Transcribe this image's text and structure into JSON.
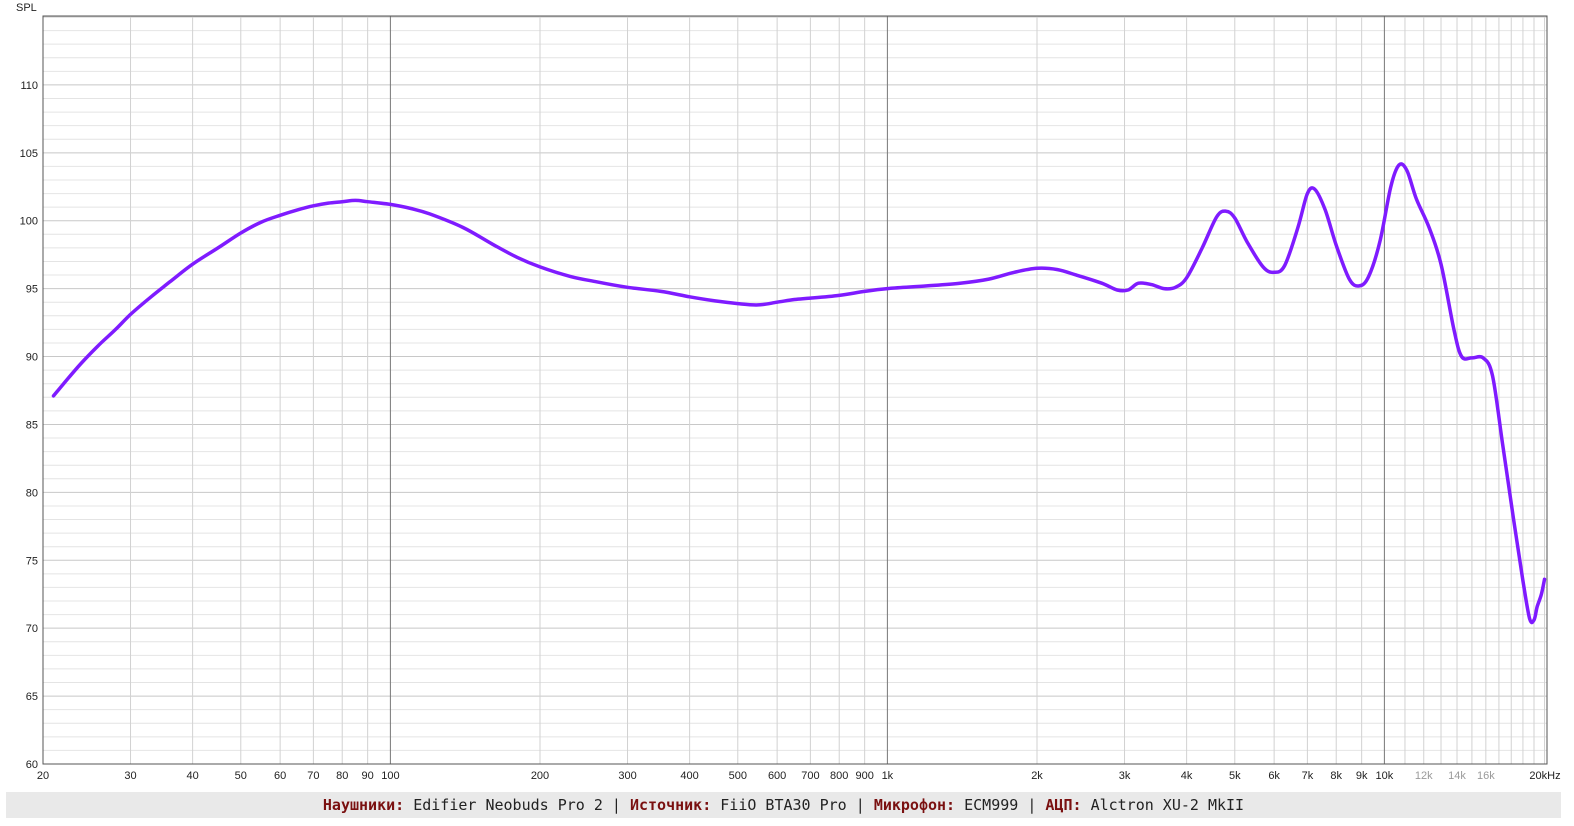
{
  "chart_data": {
    "type": "line",
    "ylabel": "SPL",
    "xscale": "log",
    "xlim": [
      20,
      20000
    ],
    "ylim": [
      60,
      115
    ],
    "grid": true,
    "y_ticks": [
      60,
      65,
      70,
      75,
      80,
      85,
      90,
      95,
      100,
      105,
      110
    ],
    "x_ticks": [
      {
        "value": 20,
        "label": "20"
      },
      {
        "value": 30,
        "label": "30"
      },
      {
        "value": 40,
        "label": "40"
      },
      {
        "value": 50,
        "label": "50"
      },
      {
        "value": 60,
        "label": "60"
      },
      {
        "value": 70,
        "label": "70"
      },
      {
        "value": 80,
        "label": "80"
      },
      {
        "value": 90,
        "label": "90"
      },
      {
        "value": 100,
        "label": "100"
      },
      {
        "value": 200,
        "label": "200"
      },
      {
        "value": 300,
        "label": "300"
      },
      {
        "value": 400,
        "label": "400"
      },
      {
        "value": 500,
        "label": "500"
      },
      {
        "value": 600,
        "label": "600"
      },
      {
        "value": 700,
        "label": "700"
      },
      {
        "value": 800,
        "label": "800"
      },
      {
        "value": 900,
        "label": "900"
      },
      {
        "value": 1000,
        "label": "1k"
      },
      {
        "value": 2000,
        "label": "2k"
      },
      {
        "value": 3000,
        "label": "3k"
      },
      {
        "value": 4000,
        "label": "4k"
      },
      {
        "value": 5000,
        "label": "5k"
      },
      {
        "value": 6000,
        "label": "6k"
      },
      {
        "value": 7000,
        "label": "7k"
      },
      {
        "value": 8000,
        "label": "8k"
      },
      {
        "value": 9000,
        "label": "9k"
      },
      {
        "value": 10000,
        "label": "10k"
      },
      {
        "value": 12000,
        "label": "12k",
        "muted": true
      },
      {
        "value": 14000,
        "label": "14k",
        "muted": true
      },
      {
        "value": 16000,
        "label": "16k",
        "muted": true
      },
      {
        "value": 20000,
        "label": "20kHz"
      }
    ],
    "series": [
      {
        "color": "#7f1bff",
        "points": [
          [
            21,
            87.1
          ],
          [
            22,
            88.0
          ],
          [
            24,
            89.6
          ],
          [
            26,
            90.9
          ],
          [
            28,
            92.0
          ],
          [
            30,
            93.1
          ],
          [
            33,
            94.4
          ],
          [
            36,
            95.5
          ],
          [
            40,
            96.8
          ],
          [
            45,
            98.0
          ],
          [
            50,
            99.1
          ],
          [
            55,
            99.9
          ],
          [
            60,
            100.4
          ],
          [
            65,
            100.8
          ],
          [
            70,
            101.1
          ],
          [
            75,
            101.3
          ],
          [
            80,
            101.4
          ],
          [
            85,
            101.5
          ],
          [
            90,
            101.4
          ],
          [
            100,
            101.2
          ],
          [
            110,
            100.9
          ],
          [
            120,
            100.5
          ],
          [
            140,
            99.5
          ],
          [
            160,
            98.3
          ],
          [
            180,
            97.3
          ],
          [
            200,
            96.6
          ],
          [
            230,
            95.9
          ],
          [
            260,
            95.5
          ],
          [
            300,
            95.1
          ],
          [
            350,
            94.8
          ],
          [
            400,
            94.4
          ],
          [
            450,
            94.1
          ],
          [
            500,
            93.9
          ],
          [
            550,
            93.8
          ],
          [
            600,
            94.0
          ],
          [
            650,
            94.2
          ],
          [
            700,
            94.3
          ],
          [
            800,
            94.5
          ],
          [
            900,
            94.8
          ],
          [
            1000,
            95.0
          ],
          [
            1200,
            95.2
          ],
          [
            1400,
            95.4
          ],
          [
            1600,
            95.7
          ],
          [
            1800,
            96.2
          ],
          [
            2000,
            96.5
          ],
          [
            2200,
            96.4
          ],
          [
            2400,
            96.0
          ],
          [
            2700,
            95.4
          ],
          [
            2900,
            94.9
          ],
          [
            3050,
            94.9
          ],
          [
            3200,
            95.4
          ],
          [
            3400,
            95.3
          ],
          [
            3600,
            95.0
          ],
          [
            3800,
            95.1
          ],
          [
            4000,
            95.8
          ],
          [
            4300,
            98.0
          ],
          [
            4600,
            100.3
          ],
          [
            4800,
            100.7
          ],
          [
            5000,
            100.2
          ],
          [
            5300,
            98.4
          ],
          [
            5700,
            96.6
          ],
          [
            6000,
            96.2
          ],
          [
            6300,
            96.7
          ],
          [
            6700,
            99.5
          ],
          [
            7000,
            102.0
          ],
          [
            7250,
            102.3
          ],
          [
            7600,
            100.8
          ],
          [
            8000,
            98.2
          ],
          [
            8500,
            95.7
          ],
          [
            8900,
            95.2
          ],
          [
            9300,
            95.9
          ],
          [
            9800,
            98.5
          ],
          [
            10300,
            102.5
          ],
          [
            10700,
            104.1
          ],
          [
            11100,
            103.7
          ],
          [
            11600,
            101.6
          ],
          [
            12300,
            99.5
          ],
          [
            13000,
            96.8
          ],
          [
            13800,
            92.0
          ],
          [
            14300,
            90.0
          ],
          [
            15000,
            89.9
          ],
          [
            15800,
            89.9
          ],
          [
            16500,
            88.6
          ],
          [
            17300,
            83.5
          ],
          [
            18200,
            78.0
          ],
          [
            19000,
            73.5
          ],
          [
            19600,
            70.7
          ],
          [
            20000,
            70.6
          ],
          [
            20300,
            71.6
          ],
          [
            20700,
            72.5
          ],
          [
            21000,
            73.6
          ]
        ]
      }
    ],
    "footer": [
      {
        "label": "Наушники:",
        "value": "Edifier Neobuds Pro 2"
      },
      {
        "label": "Источник:",
        "value": "FiiO BTA30 Pro"
      },
      {
        "label": "Микрофон:",
        "value": "ECM999"
      },
      {
        "label": "АЦП:",
        "value": "Alctron XU-2 MkII"
      }
    ]
  }
}
